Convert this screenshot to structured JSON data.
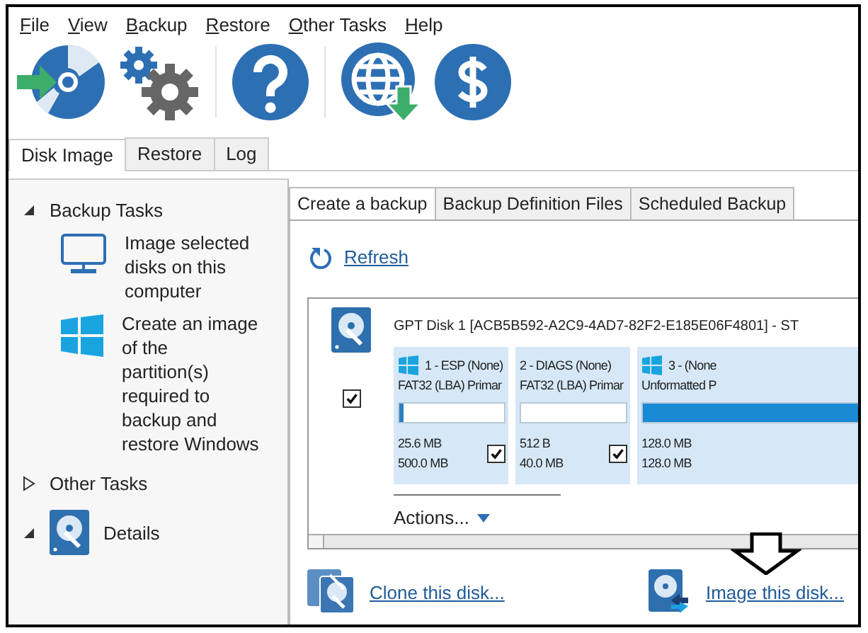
{
  "menu": [
    "File",
    "View",
    "Backup",
    "Restore",
    "Other Tasks",
    "Help"
  ],
  "left_tabs": [
    {
      "label": "Disk Image",
      "selected": true
    },
    {
      "label": "Restore",
      "selected": false
    },
    {
      "label": "Log",
      "selected": false
    }
  ],
  "sidebar": [
    {
      "kind": "plain",
      "title": "Backup Tasks",
      "expanded": true,
      "items": [
        {
          "kind": "monitor",
          "label": "Image selected disks on this computer"
        },
        {
          "kind": "windows",
          "label": "Create an image of the partition(s) required to backup and restore Windows"
        }
      ]
    },
    {
      "kind": "plain",
      "title": "Other Tasks",
      "expanded": false
    },
    {
      "kind": "disk",
      "title": "Details",
      "expanded": true
    }
  ],
  "main_tabs": [
    {
      "label": "Create a backup",
      "selected": true
    },
    {
      "label": "Backup Definition Files",
      "selected": false
    },
    {
      "label": "Scheduled Backup",
      "selected": false
    }
  ],
  "refresh": "Refresh",
  "disk": {
    "title": "GPT Disk 1 [ACB5B592-A2C9-4AD7-82F2-E185E06F4801] - ST",
    "checked": true,
    "actions": "Actions...",
    "partitions": [
      {
        "kind": "windows",
        "label": "1 - ESP (None)",
        "fs": "FAT32 (LBA) Primar",
        "level": 0.04,
        "used": "25.6 MB",
        "size": "500.0 MB",
        "checked": true
      },
      {
        "kind": "plain",
        "label": "2 - DIAGS (None)",
        "fs": "FAT32 (LBA) Primar",
        "used": "512 B",
        "size": "40.0 MB",
        "checked": true
      },
      {
        "kind": "windows",
        "label": "3 -  (None",
        "fs": "Unformatted P",
        "level": 1,
        "used": "128.0 MB",
        "size": "128.0 MB"
      }
    ]
  },
  "links": [
    {
      "kind": "clone",
      "label": "Clone this disk..."
    },
    {
      "kind": "image",
      "label": "Image this disk..."
    }
  ]
}
